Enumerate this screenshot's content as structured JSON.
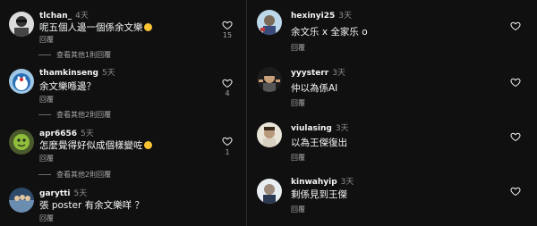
{
  "left_column": [
    {
      "username": "tlchan_",
      "time": "4天",
      "text": "呢五個人邊一個係余文樂",
      "emoji": "thinking-face",
      "reply_label": "回覆",
      "like_count": "15",
      "more_replies": "查看其他1則回覆"
    },
    {
      "username": "thamkinseng",
      "time": "5天",
      "text": "余文樂喺邊？",
      "reply_label": "回覆",
      "like_count": "4",
      "more_replies": "查看其他2則回覆"
    },
    {
      "username": "apr6656",
      "time": "5天",
      "text": "怎麼覺得好似成個樣變咗",
      "emoji": "thinking-face",
      "reply_label": "回覆",
      "like_count": "1",
      "more_replies": "查看其他2則回覆"
    },
    {
      "username": "garytti",
      "time": "5天",
      "text": "張 poster 有余文樂咩 ？",
      "reply_label": "回覆"
    }
  ],
  "right_column": [
    {
      "username": "hexinyi25",
      "time": "3天",
      "text": "余文乐 x 全家乐 o",
      "reply_label": "回覆"
    },
    {
      "username": "yyysterr",
      "time": "3天",
      "text": "仲以為係AI",
      "reply_label": "回覆"
    },
    {
      "username": "viulasing",
      "time": "3天",
      "text": "以為王傑復出",
      "reply_label": "回覆"
    },
    {
      "username": "kinwahyip",
      "time": "3天",
      "text": "剩係見到王傑",
      "reply_label": "回覆"
    }
  ],
  "colors": {
    "background": "#101010",
    "primary_text": "#f3f5f7",
    "secondary_text": "#a8a8a8",
    "timestamp": "#8e8e8e"
  }
}
